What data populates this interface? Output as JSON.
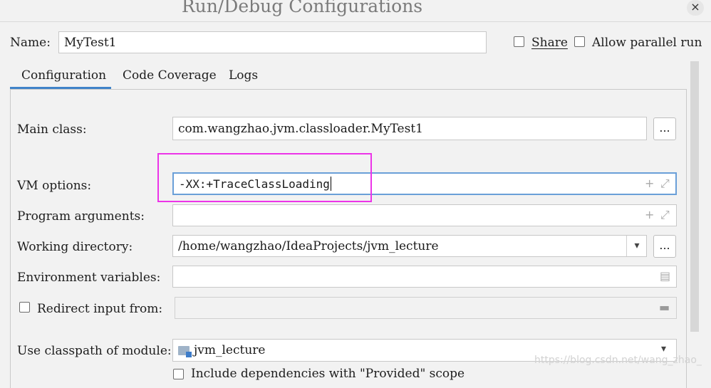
{
  "window": {
    "title": "Run/Debug Configurations",
    "close_glyph": "×"
  },
  "header": {
    "name_label": "Name:",
    "name_value": "MyTest1",
    "share_label": "Share",
    "parallel_label": "Allow parallel run"
  },
  "tabs": [
    {
      "label": "Configuration",
      "active": true
    },
    {
      "label": "Code Coverage",
      "active": false
    },
    {
      "label": "Logs",
      "active": false
    }
  ],
  "form": {
    "main_class": {
      "label": "Main class:",
      "value": "com.wangzhao.jvm.classloader.MyTest1",
      "button": "..."
    },
    "vm_options": {
      "label": "VM options:",
      "value": "-XX:+TraceClassLoading"
    },
    "program_arguments": {
      "label": "Program arguments:",
      "value": ""
    },
    "working_directory": {
      "label": "Working directory:",
      "value": "/home/wangzhao/IdeaProjects/jvm_lecture",
      "button": "..."
    },
    "environment_variables": {
      "label": "Environment variables:",
      "value": ""
    },
    "redirect_input": {
      "label": "Redirect input from:",
      "checked": false,
      "value": ""
    },
    "classpath_module": {
      "label": "Use classpath of module:",
      "value": "jvm_lecture"
    },
    "include_dependencies": {
      "label": "Include dependencies with \"Provided\" scope"
    }
  },
  "icons": {
    "plus": "+",
    "expand": "⤢",
    "dropdown": "▾",
    "doc": "▤",
    "folder": "▬"
  },
  "colors": {
    "highlight": "#ec34e8",
    "tab_accent": "#4083c9"
  },
  "watermark": "https://blog.csdn.net/wang_zhao_"
}
